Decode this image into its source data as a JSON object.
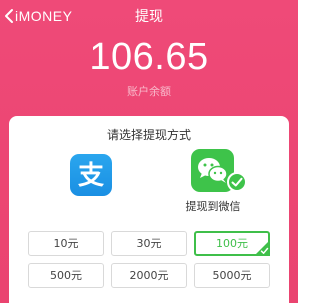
{
  "nav": {
    "back_label": "iMONEY",
    "title": "提现"
  },
  "balance": {
    "amount": "106.65",
    "label": "账户余额"
  },
  "withdraw": {
    "title": "请选择提现方式",
    "methods": [
      {
        "name": "alipay",
        "label": "",
        "selected": false
      },
      {
        "name": "wechat",
        "label": "提现到微信",
        "selected": true
      }
    ],
    "amounts": [
      {
        "label": "10元",
        "selected": false
      },
      {
        "label": "30元",
        "selected": false
      },
      {
        "label": "100元",
        "selected": true
      },
      {
        "label": "500元",
        "selected": false
      },
      {
        "label": "2000元",
        "selected": false
      },
      {
        "label": "5000元",
        "selected": false
      }
    ]
  },
  "colors": {
    "header_pink": "#ec4673",
    "alipay_blue": "#1a8fe3",
    "wechat_green": "#3ec34a",
    "selected_green": "#3fbf4a"
  }
}
